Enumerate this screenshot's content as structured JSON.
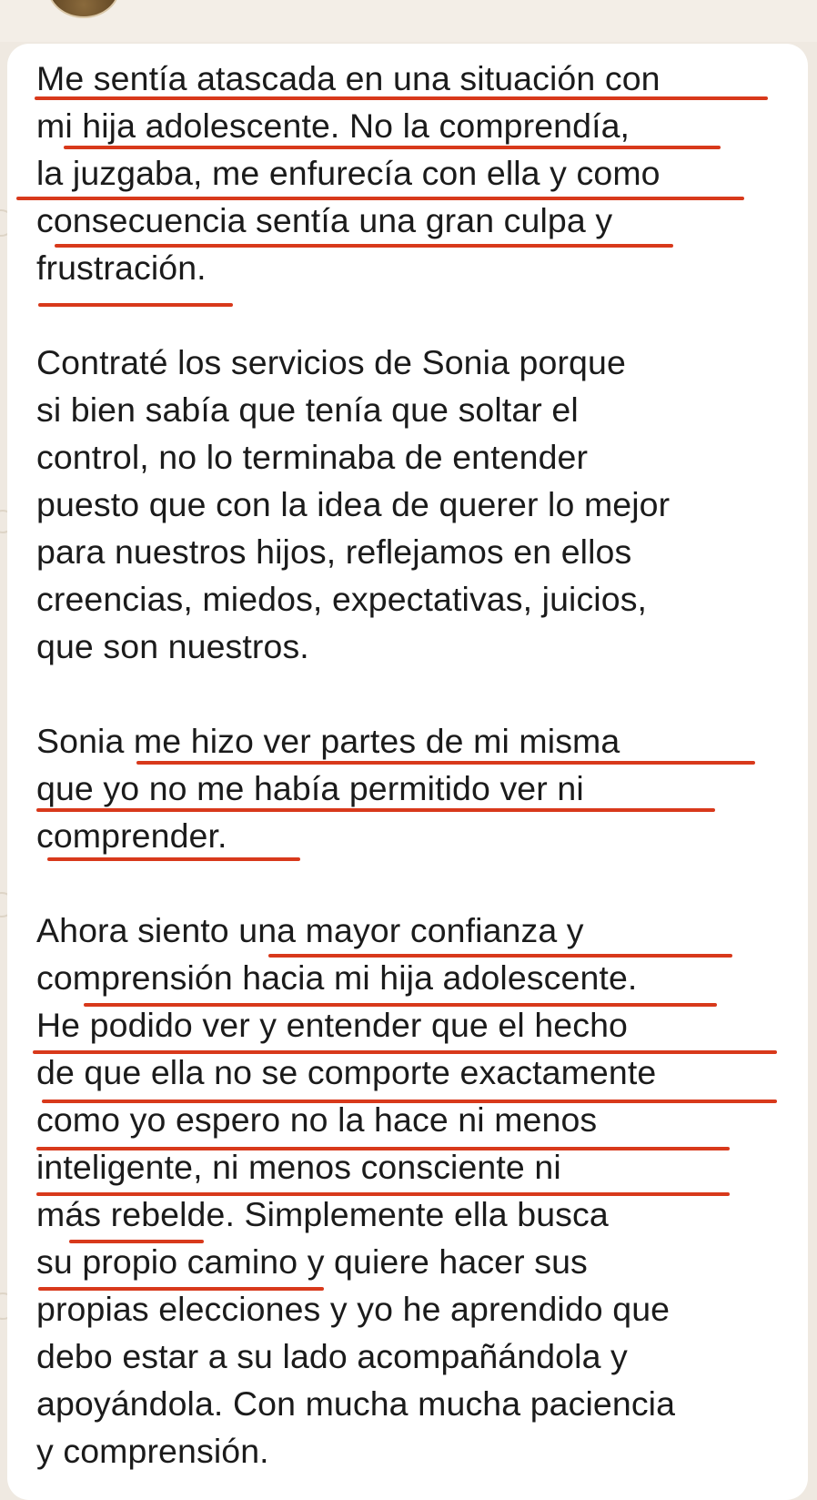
{
  "chat": {
    "sender_avatar": "contact-avatar",
    "message_lines": [
      "Me sentía atascada en una situación con",
      "mi hija adolescente. No la comprendía,",
      "la juzgaba, me enfurecía con ella y como",
      "consecuencia sentía una gran culpa y",
      "frustración.",
      "",
      "Contraté los servicios de Sonia porque",
      "si bien sabía que tenía que soltar el",
      "control, no lo terminaba de entender",
      "puesto que con la idea de querer lo mejor",
      "para nuestros hijos, reflejamos en ellos",
      "creencias, miedos, expectativas, juicios,",
      "que son nuestros.",
      "",
      "Sonia me hizo ver partes de mi misma",
      "que yo no me había permitido ver ni",
      "comprender.",
      "",
      "Ahora siento una mayor confianza y",
      "comprensión hacia mi hija adolescente.",
      "He podido ver y entender que el hecho",
      "de que ella no se comporte exactamente",
      "como yo espero no la hace ni menos",
      "inteligente, ni menos consciente ni",
      "más rebelde. Simplemente ella busca",
      "su propio camino y quiere hacer sus",
      "propias elecciones y yo he aprendido que",
      "debo estar a su lado acompañándola y",
      "apoyándola. Con mucha mucha paciencia",
      "y comprensión."
    ]
  },
  "colors": {
    "underline": "#d8391b",
    "bubble": "#ffffff",
    "background": "#efe9e1",
    "text": "#1b1b1b"
  }
}
